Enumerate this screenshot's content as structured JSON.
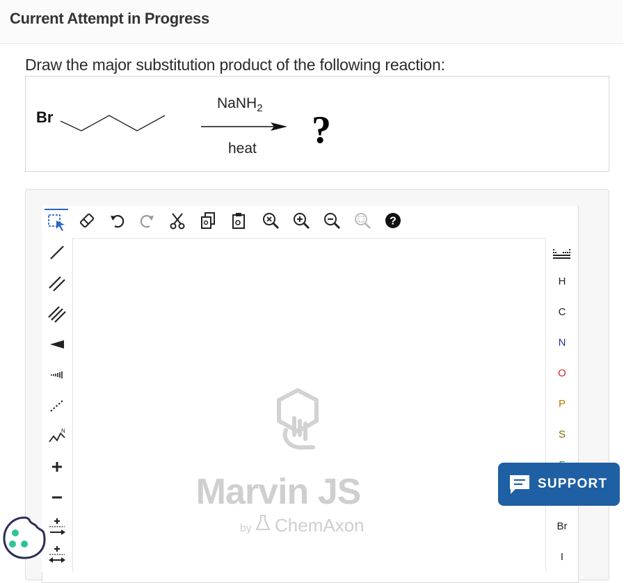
{
  "page": {
    "title": "Current Attempt in Progress"
  },
  "question": {
    "text": "Draw the major substitution product of the following reaction:"
  },
  "reaction": {
    "reactant_label": "Br",
    "reagent": "NaNH",
    "reagent_subscript": "2",
    "condition": "heat",
    "product": "?"
  },
  "toolbar": {
    "icons": [
      "select-icon",
      "erase-icon",
      "undo-icon",
      "redo-icon",
      "cut-icon",
      "copy-icon",
      "paste-icon",
      "zoom-reset-icon",
      "zoom-in-icon",
      "zoom-out-icon",
      "zoom-fit-icon",
      "help-icon"
    ]
  },
  "left_tools": [
    "single-bond-icon",
    "double-bond-icon",
    "triple-bond-icon",
    "wedge-bond-icon",
    "hash-bond-icon",
    "dashed-bond-icon",
    "chain-icon",
    "plus-charge-icon",
    "minus-charge-icon",
    "increase-charge-icon",
    "decrease-charge-icon"
  ],
  "elements": {
    "H": "H",
    "C": "C",
    "N": "N",
    "O": "O",
    "P": "P",
    "S": "S",
    "F": "F",
    "Br": "Br",
    "I": "I"
  },
  "element_colors": {
    "O": "#e02020",
    "P": "#b87800",
    "N": "#2030a0",
    "S": "#7a6a00"
  },
  "canvas": {
    "logo_name": "Marvin JS",
    "by": "by",
    "company": "ChemAxon"
  },
  "support": {
    "label": "SUPPORT"
  },
  "colors": {
    "support_bg": "#1f5fa3",
    "cookie": "#2ec49a"
  }
}
